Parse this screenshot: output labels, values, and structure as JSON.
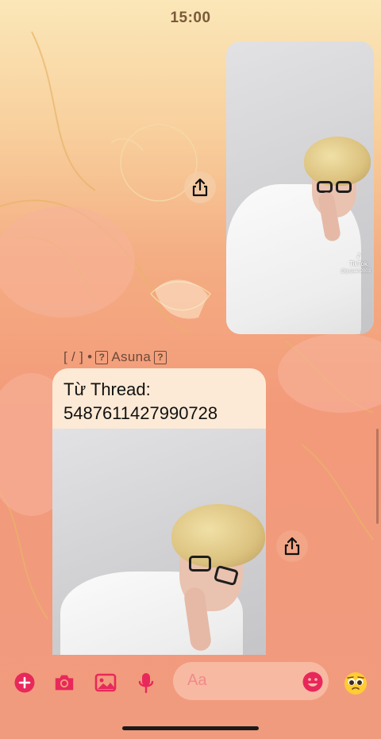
{
  "status_bar": {
    "time": "15:00"
  },
  "thread": {
    "sender_name": "[ / ] • ⍰Asuna⍰",
    "sender_parts": {
      "prefix": "[ / ] •",
      "name": "Asuna"
    },
    "message_lines": [
      "Từ Thread:",
      "5487611427990728"
    ]
  },
  "media": {
    "first": {
      "watermark": "TikTok",
      "watermark_handle": "@g.quan2003"
    }
  },
  "composer": {
    "placeholder": "Aa",
    "icons": [
      "plus-icon",
      "camera-icon",
      "gallery-icon",
      "mic-icon",
      "emoji-icon",
      "pleading-face-emoji"
    ]
  },
  "colors": {
    "accent": "#e8285a",
    "bubble": "#fcead6",
    "label": "#6d4a3a"
  }
}
